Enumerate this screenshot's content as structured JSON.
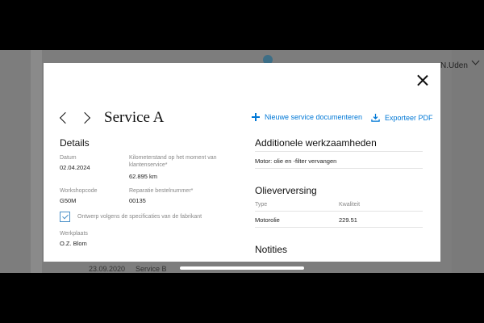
{
  "background": {
    "user": "N.Uden",
    "row_date": "23.09.2020",
    "row_service": "Service B"
  },
  "header": {
    "title": "Service A"
  },
  "actions": {
    "new_docs": "Nieuwe service documenteren",
    "export_pdf": "Exporteer PDF"
  },
  "details": {
    "heading": "Details",
    "datum_label": "Datum",
    "datum_value": "02.04.2024",
    "km_label": "Kilometerstand op het moment van klantenservice*",
    "km_value": "62.895 km",
    "workshop_label": "Workshopcode",
    "workshop_value": "G50M",
    "order_label": "Reparatie bestelnummer*",
    "order_value": "00135",
    "spec_label": "Ontwerp volgens de specificaties van de fabrikant",
    "spec_checked": true,
    "werkplaats_label": "Werkplaats",
    "werkplaats_value": "O.Z. Blom"
  },
  "additional": {
    "heading": "Additionele werkzaamheden",
    "item": "Motor: olie en -filter vervangen"
  },
  "oil": {
    "heading": "Olieverversing",
    "col_type": "Type",
    "col_quality": "Kwaliteit",
    "type_value": "Motorolie",
    "quality_value": "229.51"
  },
  "notes": {
    "heading": "Notities"
  },
  "colors": {
    "accent": "#0078d6",
    "checkbox": "#4a90c8"
  }
}
